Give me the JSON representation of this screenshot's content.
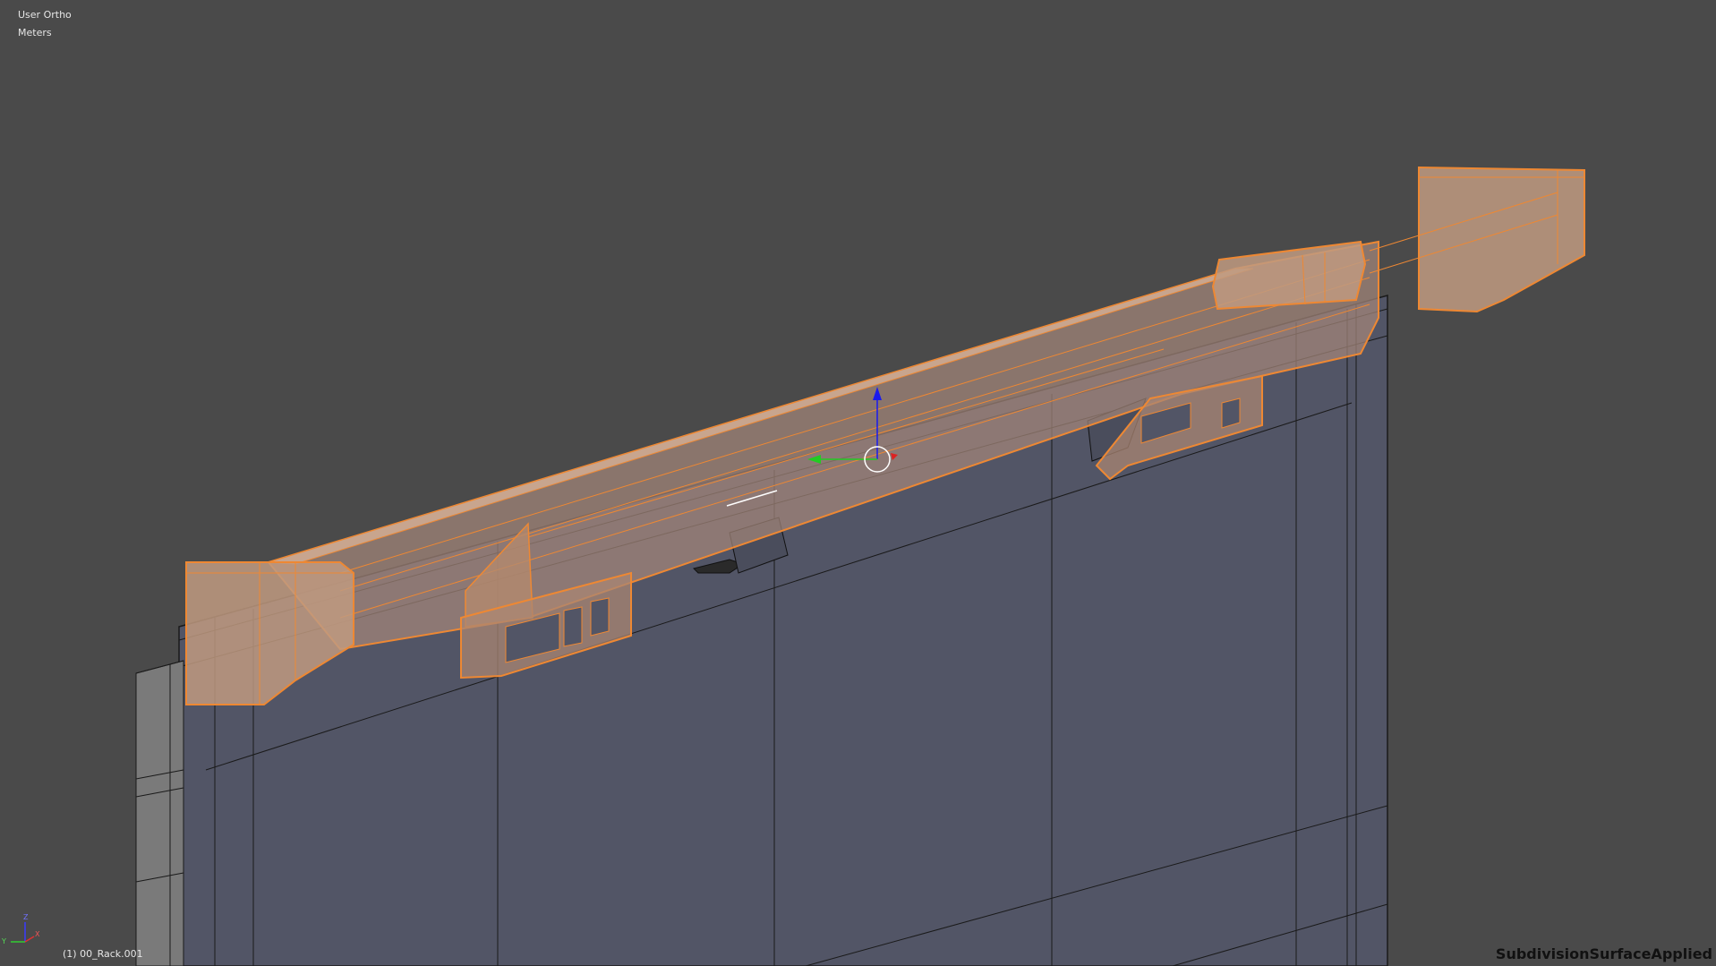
{
  "viewport": {
    "view_name": "User Ortho",
    "unit_label": "Meters",
    "object_label": "(1) 00_Rack.001",
    "modifier_label": "SubdivisionSurfaceApplied"
  },
  "axis_indicator": {
    "x_label": "X",
    "y_label": "Y",
    "z_label": "Z"
  },
  "colors": {
    "background": "#4a4a4a",
    "wall_face": "#525566",
    "selection_outline": "#ee8833",
    "selected_face": "#b48a6e",
    "gizmo_z": "#1a1aee",
    "gizmo_y": "#22cc22",
    "gizmo_x": "#dd2222"
  }
}
